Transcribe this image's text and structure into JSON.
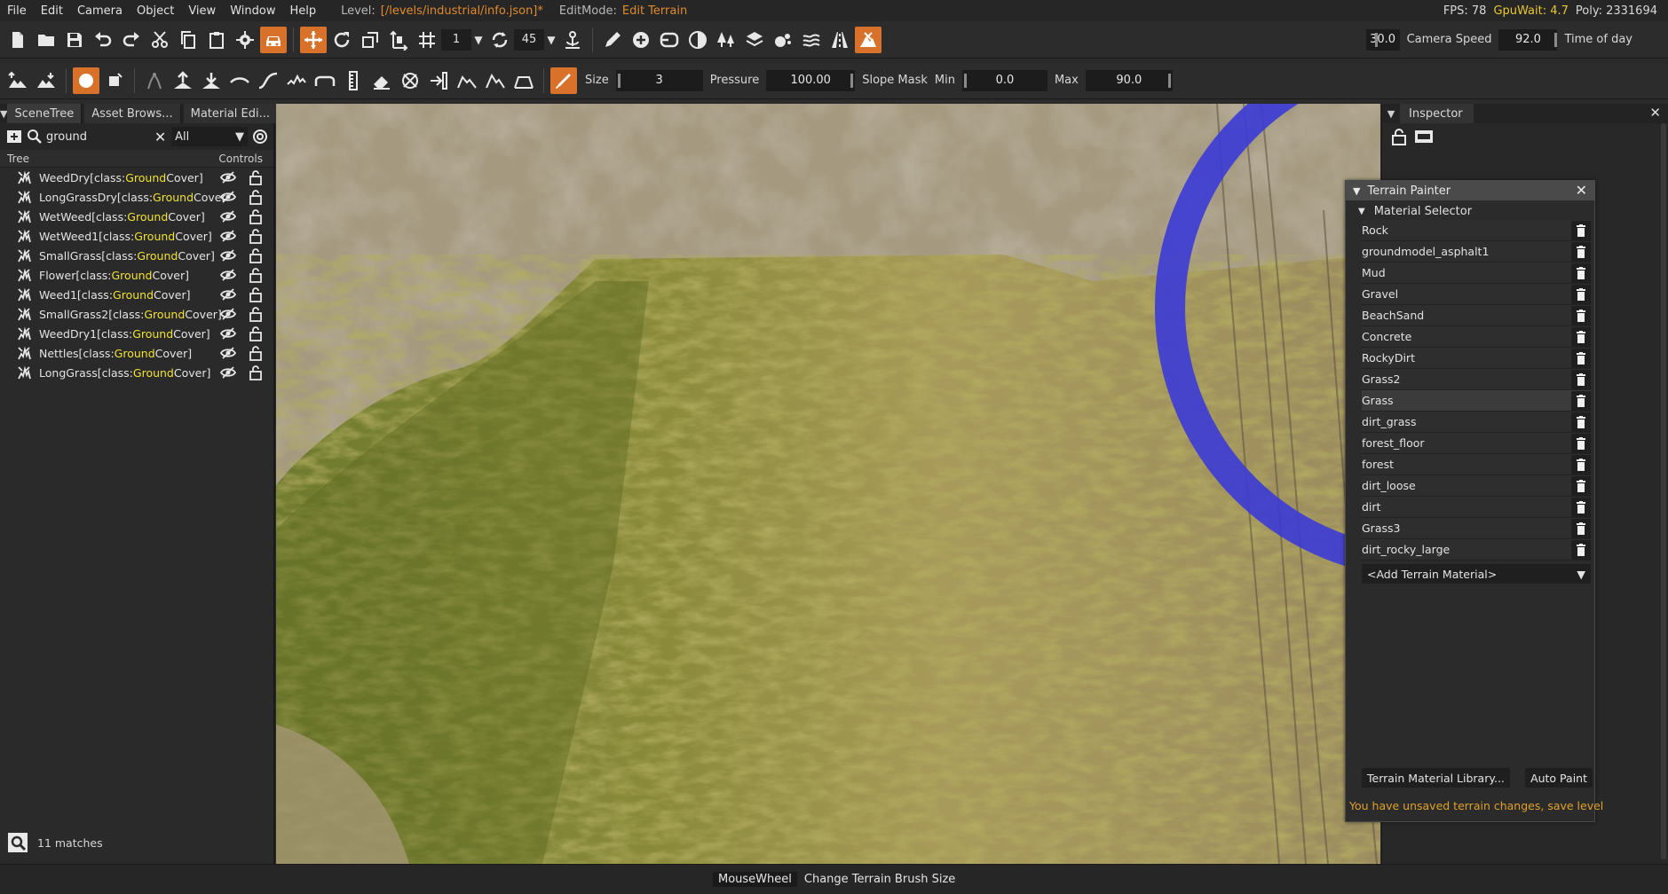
{
  "menu": {
    "items": [
      "File",
      "Edit",
      "Camera",
      "Object",
      "View",
      "Window",
      "Help"
    ],
    "level_label": "Level:",
    "level_value": "[/levels/industrial/info.json]*",
    "editmode_label": "EditMode:",
    "editmode_value": "Edit Terrain",
    "fps": "FPS: 78",
    "gpuwait": "GpuWait: 4.7",
    "poly": "Poly: 2331694"
  },
  "toolbar1": {
    "snap_value": "1",
    "angle_value": "45",
    "camera_speed_value": "30.0",
    "camera_speed_label": "Camera Speed",
    "time_of_day_value": "92.0",
    "time_of_day_label": "Time of day"
  },
  "toolbar2": {
    "size_label": "Size",
    "size_value": "3",
    "pressure_label": "Pressure",
    "pressure_value": "100.00",
    "slope_mask_label": "Slope Mask",
    "min_label": "Min",
    "min_value": "0.0",
    "max_label": "Max",
    "max_value": "90.0"
  },
  "left_panel": {
    "tabs": [
      "SceneTree",
      "Asset Brows...",
      "Material Edi..."
    ],
    "search_value": "ground",
    "filter_value": "All",
    "tree_header": "Tree",
    "controls_header": "Controls",
    "rows": [
      {
        "name": "WeedDry",
        "cls_pre": " [class: ",
        "hl": "Ground",
        "rest": "Cover]"
      },
      {
        "name": "LongGrassDry",
        "cls_pre": " [class: ",
        "hl": "Ground",
        "rest": "Cover"
      },
      {
        "name": "WetWeed",
        "cls_pre": " [class: ",
        "hl": "Ground",
        "rest": "Cover]"
      },
      {
        "name": "WetWeed1",
        "cls_pre": " [class: ",
        "hl": "Ground",
        "rest": "Cover]"
      },
      {
        "name": "SmallGrass",
        "cls_pre": " [class: ",
        "hl": "Ground",
        "rest": "Cover]"
      },
      {
        "name": "Flower",
        "cls_pre": " [class: ",
        "hl": "Ground",
        "rest": "Cover]"
      },
      {
        "name": "Weed1",
        "cls_pre": " [class: ",
        "hl": "Ground",
        "rest": "Cover]"
      },
      {
        "name": "SmallGrass2",
        "cls_pre": " [class: ",
        "hl": "Ground",
        "rest": "Cover]"
      },
      {
        "name": "WeedDry1",
        "cls_pre": " [class: ",
        "hl": "Ground",
        "rest": "Cover]"
      },
      {
        "name": "Nettles",
        "cls_pre": " [class: ",
        "hl": "Ground",
        "rest": "Cover]"
      },
      {
        "name": "LongGrass",
        "cls_pre": " [class: ",
        "hl": "Ground",
        "rest": "Cover]"
      }
    ],
    "match_count": "11 matches"
  },
  "inspector": {
    "tab": "Inspector"
  },
  "terrain_painter": {
    "title": "Terrain Painter",
    "section": "Material Selector",
    "materials": [
      "Rock",
      "groundmodel_asphalt1",
      "Mud",
      "Gravel",
      "BeachSand",
      "Concrete",
      "RockyDirt",
      "Grass2",
      "Grass",
      "dirt_grass",
      "forest_floor",
      "forest",
      "dirt_loose",
      "dirt",
      "Grass3",
      "dirt_rocky_large"
    ],
    "selected_material": "Grass",
    "add_material": "<Add Terrain Material>",
    "library_button": "Terrain Material Library...",
    "auto_paint_button": "Auto Paint",
    "warning": "You have unsaved terrain changes, save level"
  },
  "statusbar": {
    "key": "MouseWheel",
    "action": "Change Terrain Brush Size"
  },
  "colors": {
    "accent": "#d8722a",
    "highlight": "#f2e233",
    "brush_ring": "#3b3bd6",
    "warning": "#e0a02a"
  }
}
